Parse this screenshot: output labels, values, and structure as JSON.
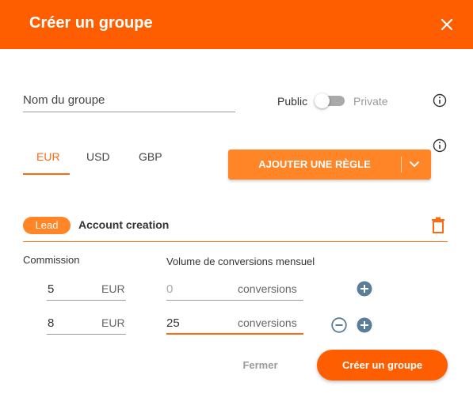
{
  "dialog": {
    "title": "Créer un groupe",
    "close_icon": "close-icon"
  },
  "group_name": {
    "placeholder": "Nom du groupe",
    "value": ""
  },
  "visibility": {
    "public_label": "Public",
    "private_label": "Private",
    "selected": "Public"
  },
  "currency_tabs": [
    {
      "label": "EUR",
      "active": true
    },
    {
      "label": "USD",
      "active": false
    },
    {
      "label": "GBP",
      "active": false
    }
  ],
  "add_rule_button": {
    "label": "AJOUTER UNE RÈGLE",
    "dropdown_icon": "chevron-down-icon"
  },
  "rule": {
    "badge": "Lead",
    "name": "Account creation",
    "delete_icon": "trash-icon",
    "commission_header": "Commission",
    "volume_header": "Volume de conversions mensuel",
    "tiers": [
      {
        "commission": "5",
        "currency": "EUR",
        "volume": "",
        "volume_placeholder": "0",
        "volume_unit": "conversions"
      },
      {
        "commission": "8",
        "currency": "EUR",
        "volume": "25",
        "volume_placeholder": "",
        "volume_unit": "conversions"
      }
    ]
  },
  "footer": {
    "close_label": "Fermer",
    "create_label": "Créer un groupe"
  },
  "colors": {
    "brand": "#ff5e00",
    "accent": "#ff8527",
    "icon_blue": "#5a7d99"
  }
}
